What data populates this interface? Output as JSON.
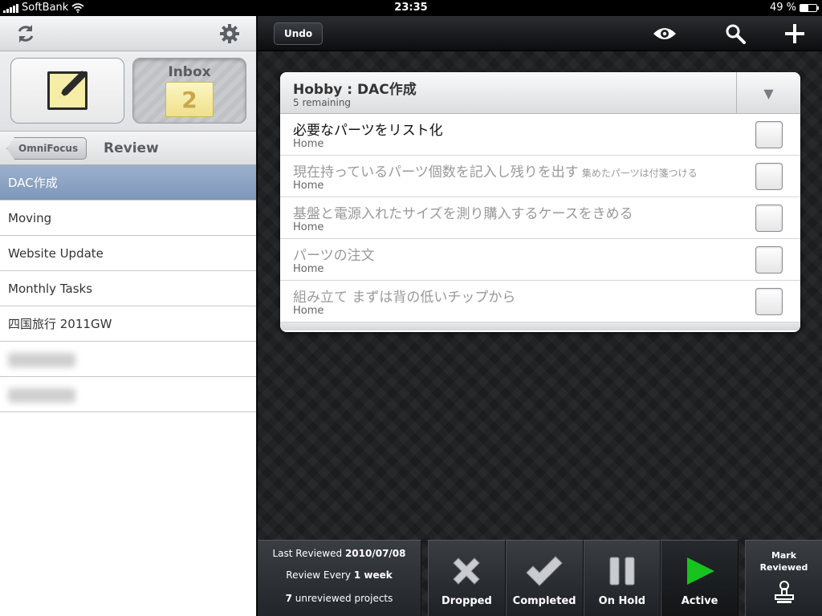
{
  "status_bar": {
    "carrier": "SoftBank",
    "time": "23:35",
    "battery": "49 %",
    "battery_level": 0.49
  },
  "sidebar": {
    "refresh_icon": "refresh-icon",
    "settings_icon": "gear-icon",
    "inbox_label": "Inbox",
    "inbox_count": "2",
    "back_button": "OmniFocus",
    "nav_title": "Review",
    "projects": [
      "DAC作成",
      "Moving",
      "Website Update",
      "Monthly Tasks",
      "四国旅行 2011GW"
    ]
  },
  "toolbar": {
    "undo_label": "Undo",
    "view_icon": "eye-icon",
    "search_icon": "search-icon",
    "add_icon": "plus-icon"
  },
  "project": {
    "title": "Hobby : DAC作成",
    "remaining": "5 remaining",
    "tasks": [
      {
        "title": "必要なパーツをリスト化",
        "note": "",
        "context": "Home"
      },
      {
        "title": "現在持っているパーツ個数を記入し残りを出す",
        "note": "集めたパーツは付箋つける",
        "context": "Home"
      },
      {
        "title": "基盤と電源入れたサイズを測り購入するケースをきめる",
        "note": "",
        "context": "Home"
      },
      {
        "title": "パーツの注文",
        "note": "",
        "context": "Home"
      },
      {
        "title": "組み立て まずは背の低いチップから",
        "note": "",
        "context": "Home"
      }
    ]
  },
  "review": {
    "last_reviewed_label": "Last Reviewed",
    "last_reviewed_value": "2010/07/08",
    "review_every_label": "Review Every",
    "review_every_value": "1 week",
    "unreviewed_count": "7",
    "unreviewed_label": "unreviewed projects"
  },
  "status_buttons": {
    "dropped": "Dropped",
    "completed": "Completed",
    "on_hold": "On Hold",
    "active": "Active"
  },
  "mark_reviewed": {
    "line1": "Mark",
    "line2": "Reviewed"
  },
  "colors": {
    "accent_green": "#18c21f",
    "selected_row": "#8ba2c3"
  }
}
